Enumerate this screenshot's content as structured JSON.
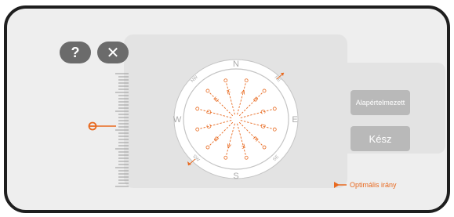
{
  "toolbar": {
    "help_label": "?",
    "close_label": "✕"
  },
  "compass": {
    "north": "N",
    "south": "S",
    "east": "E",
    "west": "W",
    "northeast": "NE",
    "northwest": "NW",
    "southeast": "SE",
    "southwest": "SW",
    "spoke_labels": [
      "A",
      "B",
      "C",
      "D",
      "E",
      "F",
      "A",
      "B",
      "C",
      "D",
      "E",
      "F"
    ]
  },
  "buttons": {
    "default_label": "Alapértelmezett",
    "done_label": "Kész"
  },
  "legend": {
    "optimal_direction": "Optimális irány"
  },
  "colors": {
    "accent": "#e8691f",
    "frame": "#1e1e1e",
    "background": "#eeeeee",
    "panel": "#e3e3e3",
    "button": "#b9b9b9",
    "tool_button": "#6b6b6b"
  },
  "icons": [
    "help-icon",
    "close-icon",
    "ruler-slider-icon",
    "direction-arrow-icon"
  ]
}
